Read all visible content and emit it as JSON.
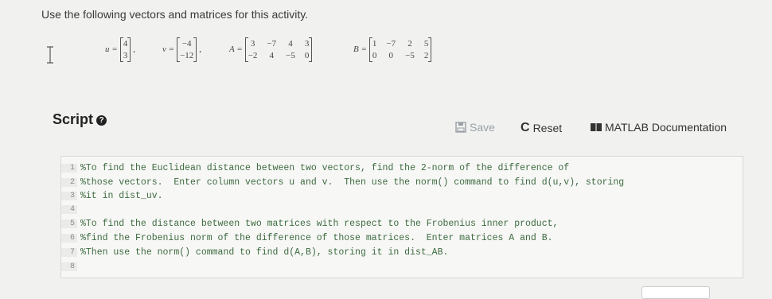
{
  "instruction": "Use the following vectors and matrices for this activity.",
  "vectors": {
    "u": {
      "label": "u =",
      "values": [
        "4",
        "3"
      ]
    },
    "v": {
      "label": "v =",
      "values": [
        "−4",
        "−12"
      ]
    }
  },
  "matrices": {
    "A": {
      "label": "A =",
      "rows": [
        [
          "3",
          "−7",
          "4",
          "3"
        ],
        [
          "−2",
          "4",
          "−5",
          "0"
        ]
      ]
    },
    "B": {
      "label": "B =",
      "rows": [
        [
          "1",
          "−7",
          "2",
          "5"
        ],
        [
          "0",
          "0",
          "−5",
          "2"
        ]
      ]
    }
  },
  "script": {
    "title": "Script"
  },
  "toolbar": {
    "save_label": "Save",
    "reset_label": "Reset",
    "doc_label": "MATLAB Documentation"
  },
  "editor": {
    "lines": [
      {
        "num": "1",
        "text": "%To find the Euclidean distance between two vectors, find the 2-norm of the difference of"
      },
      {
        "num": "2",
        "text": "%those vectors.  Enter column vectors u and v.  Then use the norm() command to find d(u,v), storing"
      },
      {
        "num": "3",
        "text": "%it in dist_uv."
      },
      {
        "num": "4",
        "text": ""
      },
      {
        "num": "5",
        "text": "%To find the distance between two matrices with respect to the Frobenius inner product,"
      },
      {
        "num": "6",
        "text": "%find the Frobenius norm of the difference of those matrices.  Enter matrices A and B."
      },
      {
        "num": "7",
        "text": "%Then use the norm() command to find d(A,B), storing it in dist_AB."
      },
      {
        "num": "8",
        "text": ""
      }
    ]
  }
}
